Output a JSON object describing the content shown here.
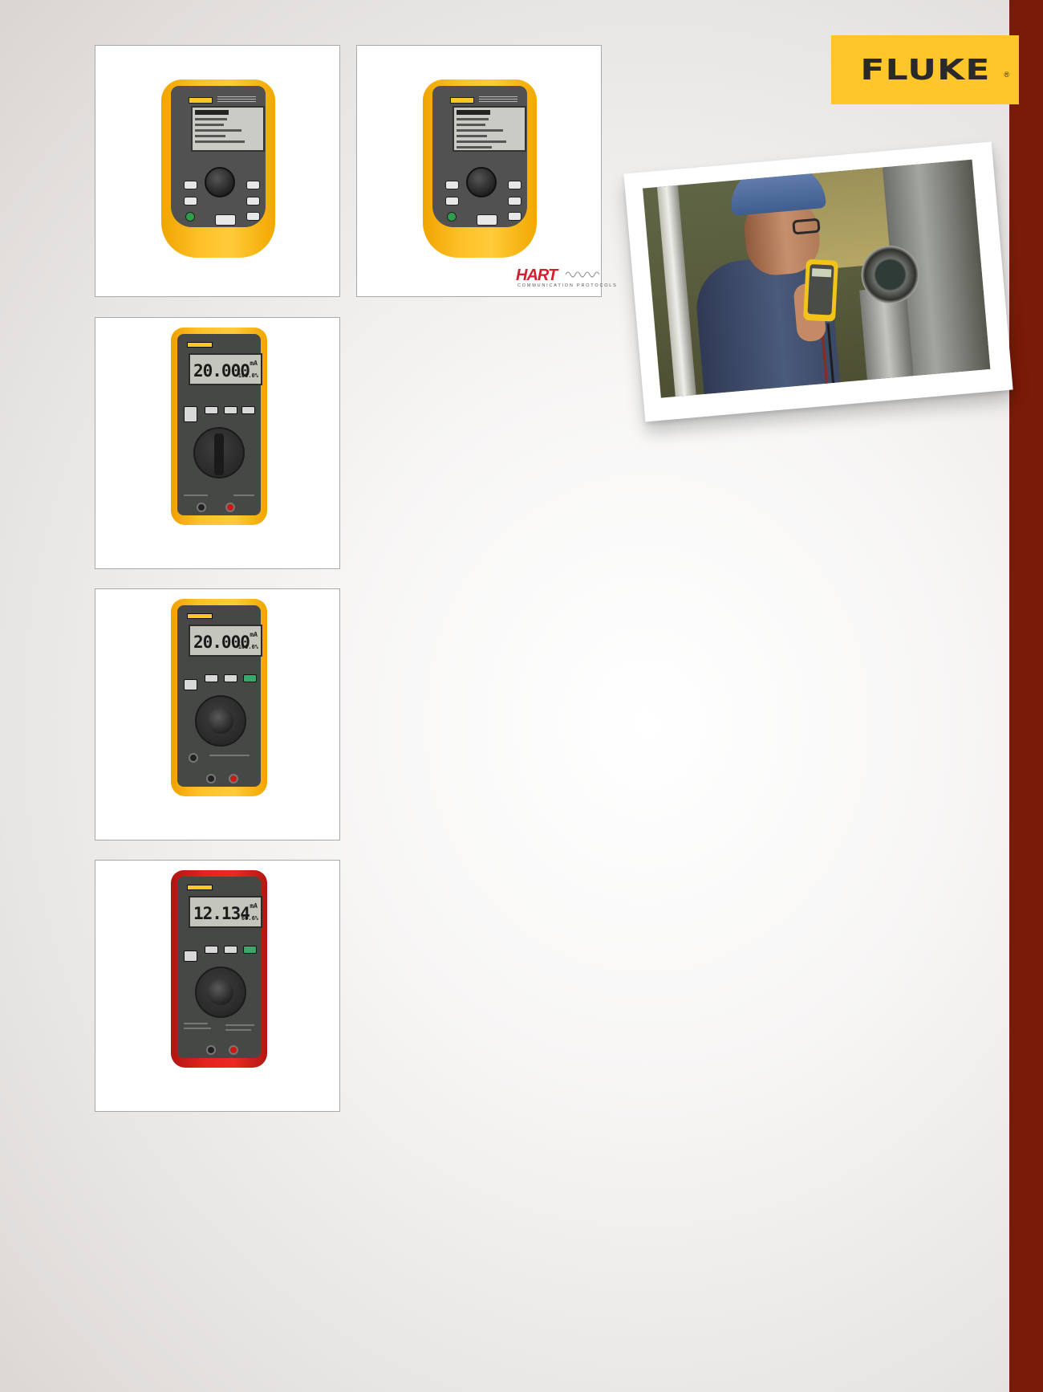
{
  "brand": {
    "logo_text": "FLUKE",
    "registered_mark": "®",
    "accent_color": "#ffc629",
    "stripe_color": "#7a1a08"
  },
  "products": [
    {
      "id": "709",
      "case_color": "#ffc12a"
    },
    {
      "id": "709H",
      "case_color": "#ffc12a",
      "badge": {
        "name": "HART",
        "subtitle": "COMMUNICATION PROTOCOLS",
        "color": "#d3202c"
      }
    },
    {
      "id": "705",
      "case_color": "#ffc12a",
      "display_value": "20.000",
      "display_unit": "mA",
      "display_percent": "100.0%"
    },
    {
      "id": "707",
      "case_color": "#ffc12a",
      "display_value": "20.000",
      "display_unit": "mA",
      "display_percent": "100.0%"
    },
    {
      "id": "707Ex",
      "case_color": "#e3231d",
      "display_value": "12.134",
      "display_unit": "mA",
      "display_percent": "60.6%"
    }
  ],
  "photo": {
    "subject": "technician-with-calibrator"
  }
}
